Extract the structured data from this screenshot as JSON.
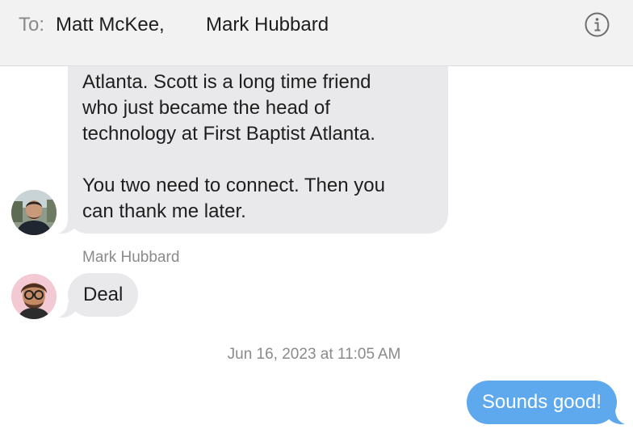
{
  "header": {
    "to_label": "To:",
    "recipients": [
      "Matt McKee,",
      "Mark Hubbard"
    ],
    "info_icon": "info-circle-icon"
  },
  "messages": [
    {
      "direction": "incoming",
      "lines": [
        "Atlanta. Scott is a long time friend",
        "who just became the head of",
        "technology at First Baptist Atlanta.",
        "",
        "You two need to connect. Then you",
        "can thank me later."
      ]
    },
    {
      "direction": "incoming",
      "sender": "Mark Hubbard",
      "text": "Deal"
    },
    {
      "direction": "outgoing",
      "text": "Sounds good!"
    }
  ],
  "timestamp": "Jun 16, 2023 at 11:05 AM",
  "colors": {
    "incoming_bubble": "#e9e9eb",
    "outgoing_bubble": "#5ea9ee",
    "header_bg": "#f2f2f2"
  }
}
